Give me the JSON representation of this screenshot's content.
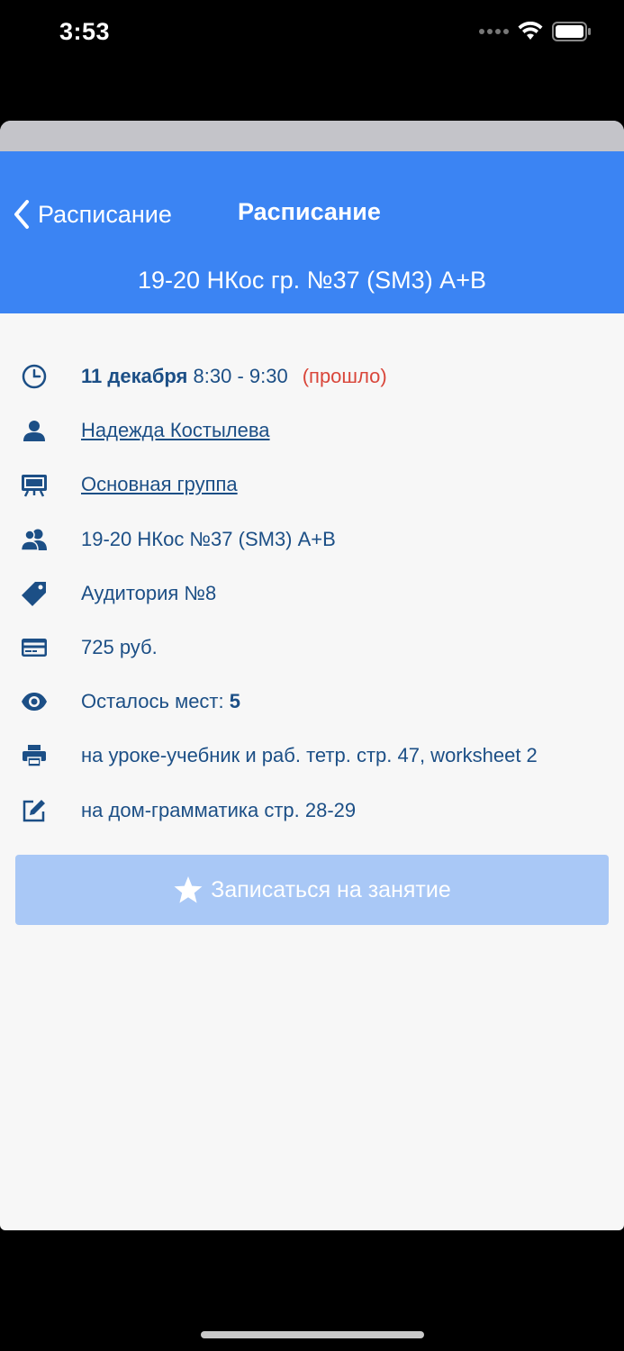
{
  "status_bar": {
    "time": "3:53",
    "icons": [
      "signal-icon",
      "wifi-icon",
      "battery-icon"
    ]
  },
  "nav": {
    "back_label": "Расписание",
    "title": "Расписание",
    "subtitle": "19-20 НКос гр. №37 (SM3) A+B"
  },
  "lesson": {
    "date": "11 декабря",
    "time": "8:30 - 9:30",
    "status": "(прошло)",
    "teacher": "Надежда Костылева",
    "course": "Основная группа",
    "group": "19-20 НКос №37 (SM3) A+B",
    "room": "Аудитория №8",
    "price": "725 руб.",
    "seats_label": "Осталось мест:",
    "seats_value": "5",
    "classwork": "на уроке-учебник и раб. тетр. стр. 47, worksheet 2",
    "homework": "на дом-грамматика стр. 28-29"
  },
  "action": {
    "signup_label": "Записаться на занятие"
  },
  "colors": {
    "header": "#3b84f3",
    "text": "#1c4f86",
    "link": "#3b84f3",
    "past": "#d9463a",
    "button_disabled": "#a9c8f6"
  }
}
